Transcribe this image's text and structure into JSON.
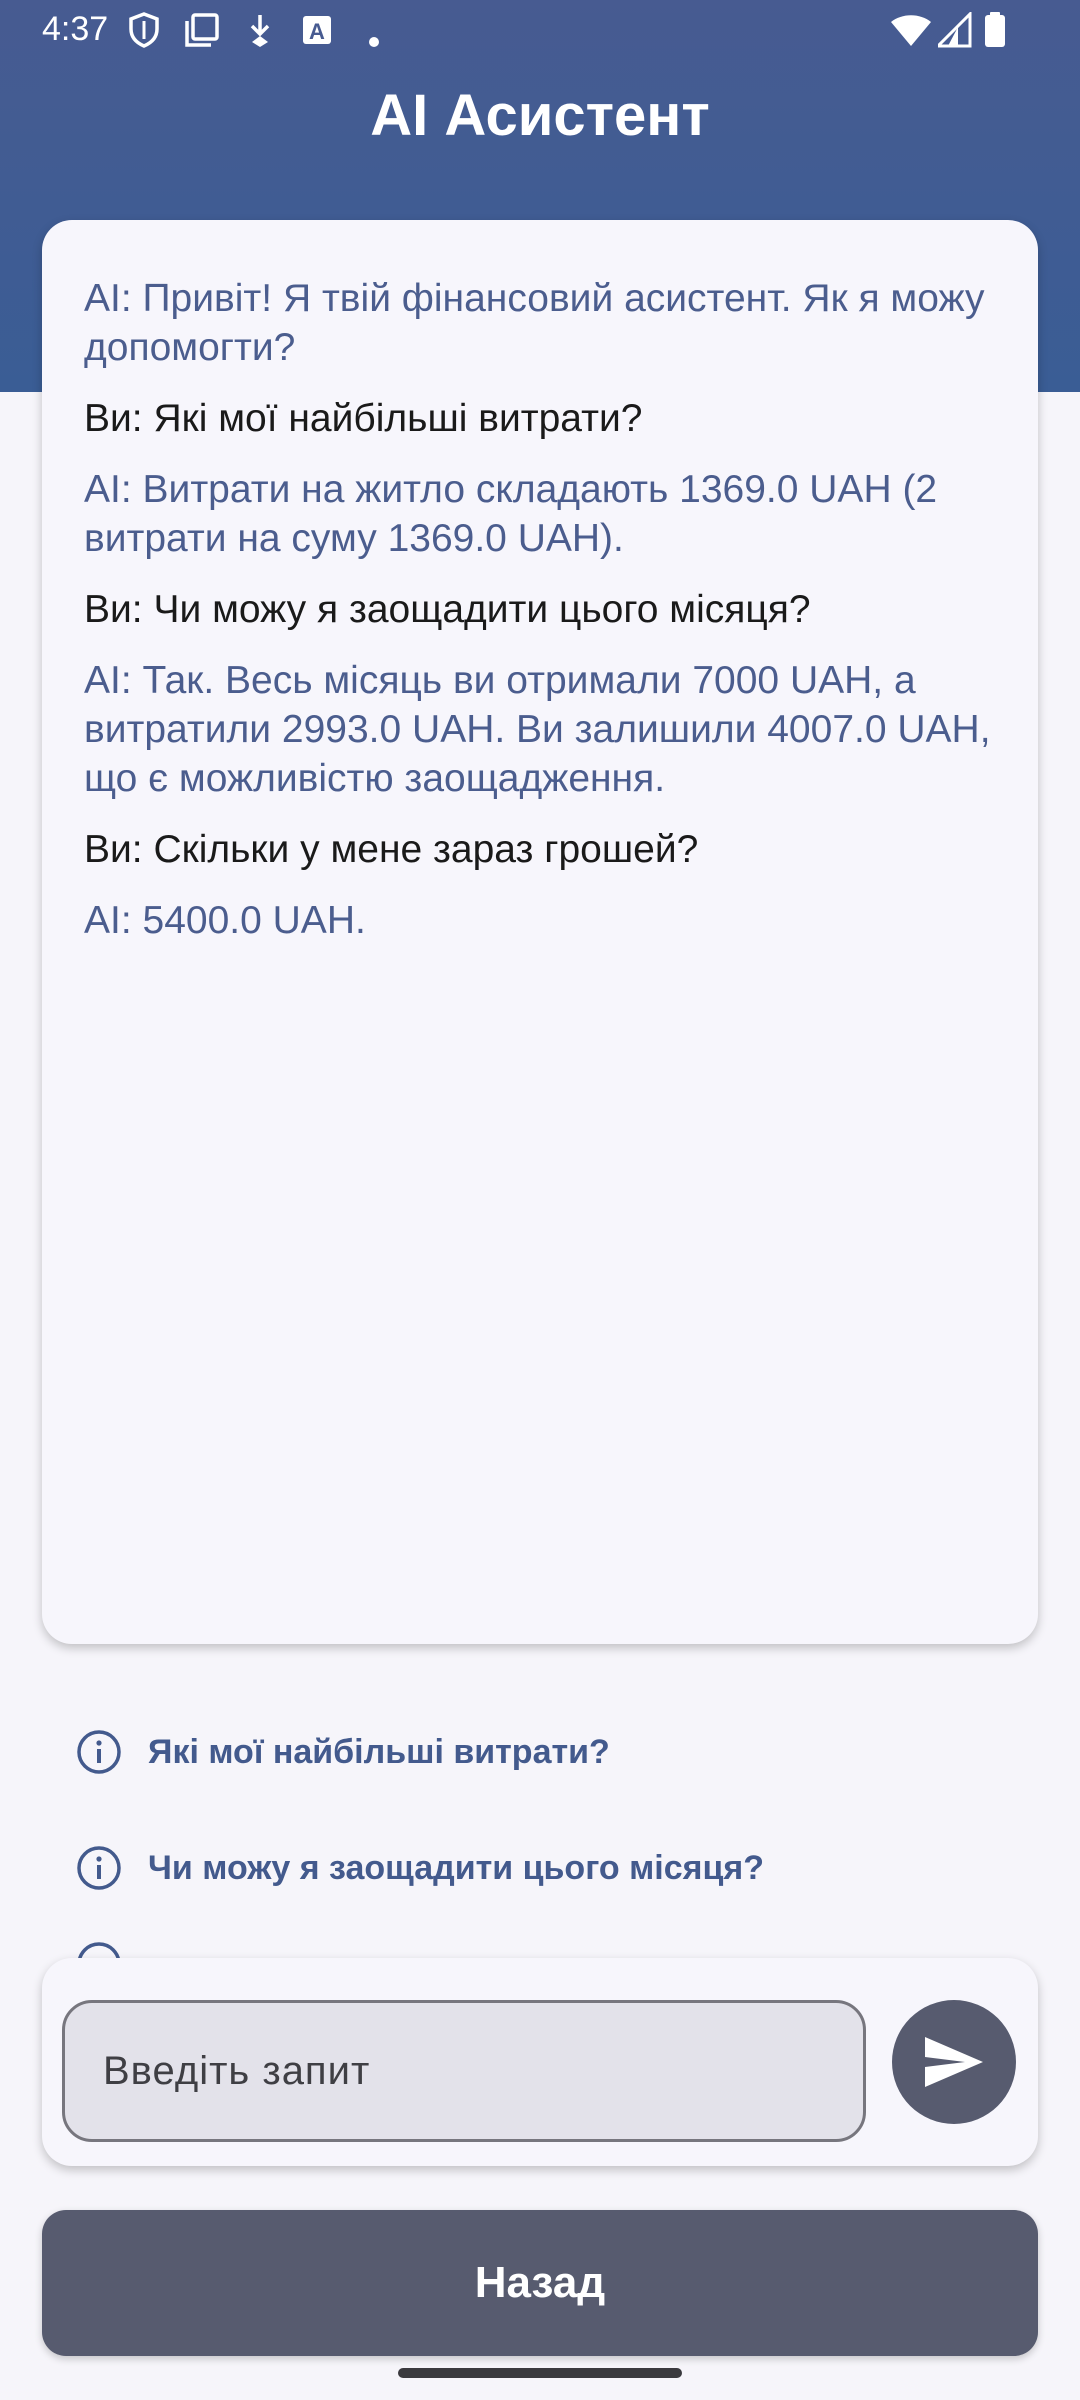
{
  "status_bar": {
    "time": "4:37",
    "left_icons": [
      "shield-icon",
      "screen-copy-icon",
      "download-icon",
      "font-a-icon",
      "dot-icon"
    ],
    "right_icons": [
      "wifi-icon",
      "signal-icon",
      "battery-icon"
    ]
  },
  "header": {
    "title": "AI Асистент",
    "background_color": "#475b91"
  },
  "chat": {
    "messages": [
      {
        "role": "ai",
        "text": "AI: Привіт! Я твій фінансовий асистент. Як я можу допомогти?"
      },
      {
        "role": "user",
        "text": "Ви: Які мої найбільші витрати?"
      },
      {
        "role": "ai",
        "text": "AI: Витрати на житло складають 1369.0 UAH (2 витрати на суму 1369.0 UAH)."
      },
      {
        "role": "user",
        "text": "Ви: Чи можу я заощадити цього місяця?"
      },
      {
        "role": "ai",
        "text": "AI: Так. Весь місяць ви отримали 7000 UAH, а витратили 2993.0 UAH. Ви залишили 4007.0 UAH, що є можливістю заощадження."
      },
      {
        "role": "user",
        "text": "Ви: Скільки у мене зараз грошей?"
      },
      {
        "role": "ai",
        "text": "AI: 5400.0 UAH."
      }
    ]
  },
  "suggestions": {
    "items": [
      {
        "label": "Які мої найбільші витрати?",
        "icon": "info-icon"
      },
      {
        "label": "Чи можу я заощадити цього місяця?",
        "icon": "info-icon"
      }
    ]
  },
  "input": {
    "placeholder": "Введіть запит",
    "send_icon": "send-icon"
  },
  "back_button": {
    "label": "Назад"
  },
  "colors": {
    "ai_text": "#4b5d8e",
    "user_text": "#1a1a1a",
    "button": "#575b6f",
    "suggestion_text": "#435a8d"
  }
}
